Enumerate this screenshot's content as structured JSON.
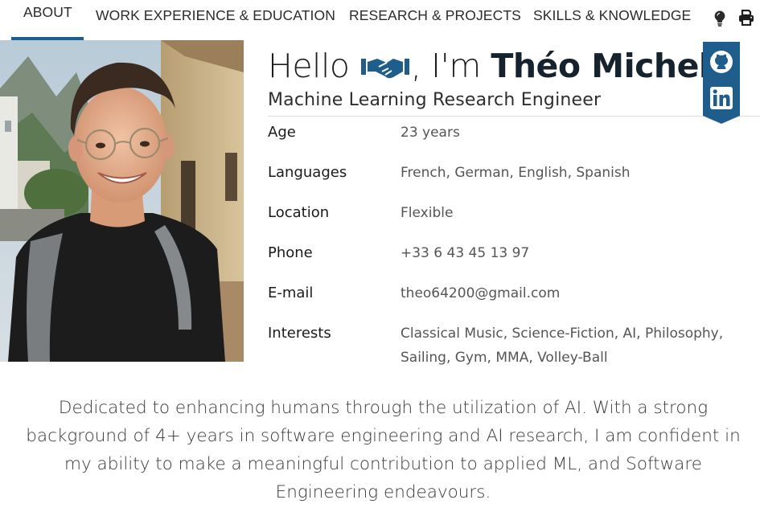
{
  "nav": {
    "tabs": [
      {
        "label": "ABOUT",
        "active": true
      },
      {
        "label": "WORK EXPERIENCE & EDUCATION",
        "active": false
      },
      {
        "label": "RESEARCH & PROJECTS",
        "active": false
      },
      {
        "label": "SKILLS & KNOWLEDGE",
        "active": false
      }
    ],
    "icons": [
      "lightbulb-icon",
      "printer-icon"
    ]
  },
  "header": {
    "greeting": "Hello",
    "greeting_icon": "handshake-icon",
    "intro": ", I'm ",
    "name": "Théo Michel",
    "title": "Machine Learning Research Engineer"
  },
  "social": [
    "github-icon",
    "linkedin-icon"
  ],
  "info": [
    {
      "label": "Age",
      "value": "23 years"
    },
    {
      "label": "Languages",
      "value": "French, German, English, Spanish"
    },
    {
      "label": "Location",
      "value": "Flexible"
    },
    {
      "label": "Phone",
      "value": "+33 6 43 45 13 97"
    },
    {
      "label": "E-mail",
      "value": "theo64200@gmail.com"
    },
    {
      "label": "Interests",
      "value": "Classical Music, Science-Fiction, AI, Philosophy, Sailing, Gym, MMA, Volley-Ball"
    }
  ],
  "bio": "Dedicated to enhancing humans through the utilization of AI. With a strong background of 4+ years in software engineering and AI research, I am confident in my ability to make a meaningful contribution to applied ML, and Software Engineering endeavours.",
  "colors": {
    "accent": "#1f5e8c",
    "ribbon": "#1f5e8c",
    "name": "#16222e"
  }
}
